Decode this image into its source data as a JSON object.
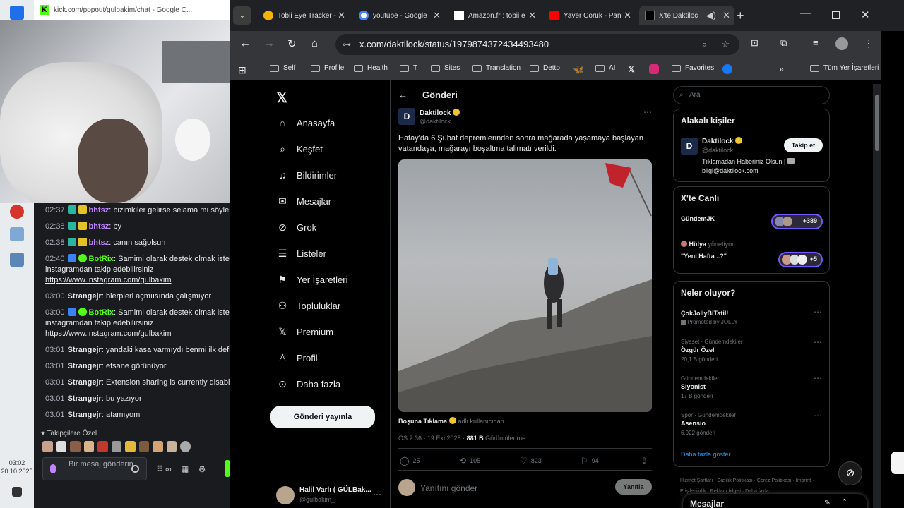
{
  "taskbar": {
    "time": "03:02",
    "date": "20.10.2025"
  },
  "kick": {
    "window_title": "kick.com/popout/gulbakim/chat - Google C...",
    "messages": [
      {
        "time": "02:37",
        "user": "bhtsz",
        "text": "bizimkiler gelirse selama mı söyle"
      },
      {
        "time": "02:38",
        "user": "bhtsz",
        "text": "by"
      },
      {
        "time": "02:38",
        "user": "bhtsz",
        "text": "canın sağolsun"
      },
      {
        "time": "02:40",
        "user": "BotRix",
        "text": "Samimi olarak destek olmak isterse",
        "line2": "instagramdan takip edebilirsiniz",
        "link": "https://www.instagram.com/gulbakim"
      },
      {
        "time": "03:00",
        "user": "Strangejr",
        "text": "bierpleri açmıısında çalışmıyor"
      },
      {
        "time": "03:00",
        "user": "BotRix",
        "text": "Samimi olarak destek olmak isterse",
        "line2": "instagramdan takip edebilirsiniz",
        "link": "https://www.instagram.com/gulbakim"
      },
      {
        "time": "03:01",
        "user": "Strangejr",
        "text": "yandaki kasa varmıydı benmi ilk defa gö"
      },
      {
        "time": "03:01",
        "user": "Strangejr",
        "text": "efsane görünüyor"
      },
      {
        "time": "03:01",
        "user": "Strangejr",
        "text": "Extension sharing is currently disabled"
      },
      {
        "time": "03:01",
        "user": "Strangejr",
        "text": "bu yazıyor"
      },
      {
        "time": "03:01",
        "user": "Strangejr",
        "text": "atamıyom"
      }
    ],
    "emote_header": "Takipçilere Özel",
    "input_placeholder": "Bir mesaj gönderin"
  },
  "browser": {
    "tabs": [
      {
        "title": "Tobii Eye Tracker -",
        "color": "#f5b400"
      },
      {
        "title": "youtube - Google",
        "color": "#4285f4"
      },
      {
        "title": "Amazon.fr : tobii e",
        "color": "#444444"
      },
      {
        "title": "Yaver Coruk - Pan",
        "color": "#ff0000"
      },
      {
        "title": "X'te Daktiloc",
        "color": "#000000"
      }
    ],
    "url": "x.com/daktilock/status/1979874372434493480",
    "bookmarks": [
      "Self",
      "Profile",
      "Health",
      "T",
      "Sites",
      "Translation",
      "Detto",
      "AI",
      "Favorites",
      "Tüm Yer İşaretleri"
    ]
  },
  "nav": {
    "items": [
      "Anasayfa",
      "Keşfet",
      "Bildirimler",
      "Mesajlar",
      "Grok",
      "Listeler",
      "Yer İşaretleri",
      "Topluluklar",
      "Premium",
      "Profil",
      "Daha fazla"
    ],
    "post_button": "Gönderi yayınla",
    "account_name": "Halil Varlı ( GÜLBak...",
    "account_handle": "@gulbakim_"
  },
  "post": {
    "header": "Gönderi",
    "author": "Daktilock",
    "handle": "@daktilock",
    "text": "Hatay'da 6 Şubat depremlerinden sonra mağarada yaşamaya başlayan vatandaşa, mağarayı boşaltma talimatı verildi.",
    "credit_user": "Boşuna Tıklama",
    "credit_suffix": "adlı kullanıcıdan",
    "meta_time": "ÖS 2:36 · 19 Eki 2025 · ",
    "views": "881 B",
    "views_label": "Görüntülenme",
    "replies": "25",
    "reposts": "105",
    "likes": "823",
    "bookmarks": "94",
    "reply_placeholder": "Yanıtını gönder",
    "reply_button": "Yanıtla"
  },
  "sidebar": {
    "search_placeholder": "Ara",
    "relevant_title": "Alakalı kişiler",
    "rel_name": "Daktilock",
    "rel_handle": "@daktilock",
    "rel_bio1": "Tıklamadan Haberiniz Olsun |",
    "rel_bio2": "bilgi@daktilock.com",
    "follow": "Takip et",
    "live_title": "X'te Canlı",
    "live1_title": "GündemJK",
    "live1_count": "+389",
    "live2_host": "Hülya",
    "live2_role": "yönetiyor",
    "live2_title": "\"Yeni Hafta ..?\"",
    "live2_count": "+5",
    "trends_title": "Neler oluyor?",
    "trends": [
      {
        "context": "",
        "name": "ÇokJollyBiTatil!",
        "sub": "Promoted by JOLLY"
      },
      {
        "context": "Siyaset · Gündemdekiler",
        "name": "Özgür Özel",
        "sub": "20,1 B gönderi"
      },
      {
        "context": "Gündemdekiler",
        "name": "Siyonist",
        "sub": "17 B gönderi"
      },
      {
        "context": "Spor · Gündemdekiler",
        "name": "Asensio",
        "sub": "6.922 gönderi"
      }
    ],
    "show_more": "Daha fazla göster",
    "footer": "Hizmet Şartları · Gizlilik Politikası · Çerez Politikası · Imprint · Erişilebilirlik · Reklam bilgisi · Daha fazla ...",
    "messages_drawer": "Mesajlar"
  }
}
